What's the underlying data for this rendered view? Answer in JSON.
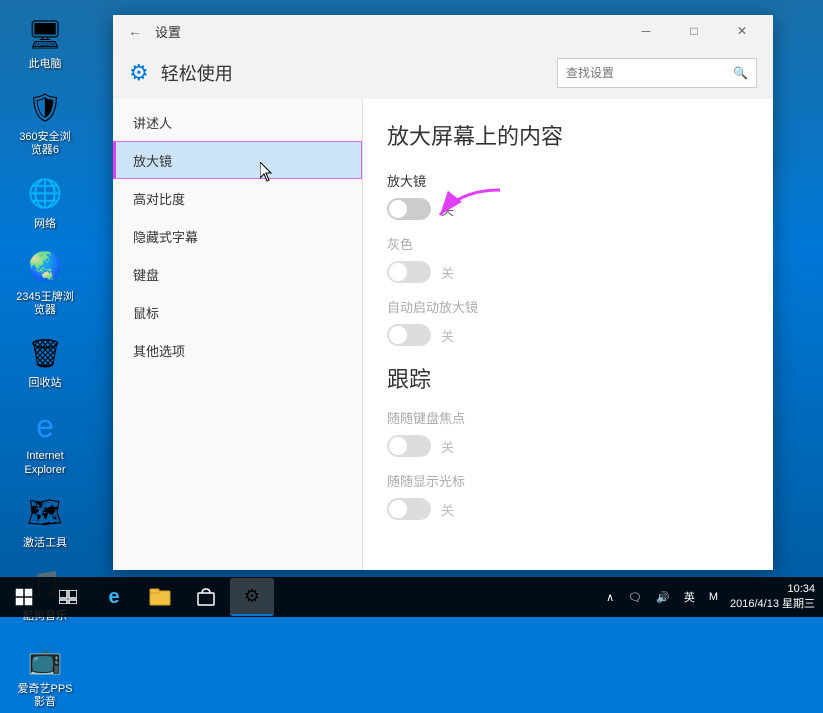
{
  "desktop": {
    "icons": [
      {
        "id": "this-pc",
        "label": "此电脑",
        "emoji": "🖥"
      },
      {
        "id": "360-browser",
        "label": "360安全浏览器6",
        "emoji": "🛡"
      },
      {
        "id": "network",
        "label": "网络",
        "emoji": "🌐"
      },
      {
        "id": "2345-browser",
        "label": "2345王牌浏览器",
        "emoji": "🌏"
      },
      {
        "id": "recycle-bin",
        "label": "回收站",
        "emoji": "🗑"
      },
      {
        "id": "ie",
        "label": "Internet Explorer",
        "emoji": "🌀"
      },
      {
        "id": "activation-tool",
        "label": "激活工具",
        "emoji": "🗺"
      },
      {
        "id": "kugou",
        "label": "酷狗音乐",
        "emoji": "🎵"
      },
      {
        "id": "aiyouxi",
        "label": "爱奇艺PPS 影音",
        "emoji": "📺"
      }
    ]
  },
  "taskbar": {
    "clock_time": "10:34",
    "clock_date": "2016/4/13 星期三",
    "tray_items": [
      "∧",
      "□",
      "♪",
      "英",
      "M"
    ]
  },
  "window": {
    "title": "设置",
    "back_button": "←",
    "minimize": "─",
    "maximize": "□",
    "close": "✕"
  },
  "settings": {
    "header_icon": "⚙",
    "header_title": "轻松使用",
    "search_placeholder": "查找设置",
    "nav_items": [
      {
        "id": "narrator",
        "label": "讲述人",
        "active": false
      },
      {
        "id": "magnifier",
        "label": "放大镜",
        "active": true
      },
      {
        "id": "high-contrast",
        "label": "高对比度",
        "active": false
      },
      {
        "id": "captions",
        "label": "隐藏式字幕",
        "active": false
      },
      {
        "id": "keyboard",
        "label": "键盘",
        "active": false
      },
      {
        "id": "mouse",
        "label": "鼠标",
        "active": false
      },
      {
        "id": "other",
        "label": "其他选项",
        "active": false
      }
    ],
    "content": {
      "title": "放大屏幕上的内容",
      "magnifier_section": "放大镜",
      "magnifier_toggle": "off",
      "magnifier_toggle_label": "关",
      "grayscale_section": "灰色",
      "grayscale_toggle": "disabled",
      "grayscale_toggle_label": "关",
      "auto_start_section": "自动启动放大镜",
      "auto_start_toggle": "disabled",
      "auto_start_toggle_label": "关",
      "tracking_title": "跟踪",
      "follow_keyboard_section": "随随键盘焦点",
      "follow_keyboard_toggle": "disabled",
      "follow_keyboard_toggle_label": "关",
      "follow_cursor_section": "随随显示光标",
      "follow_cursor_toggle": "disabled",
      "follow_cursor_toggle_label": "关"
    }
  }
}
